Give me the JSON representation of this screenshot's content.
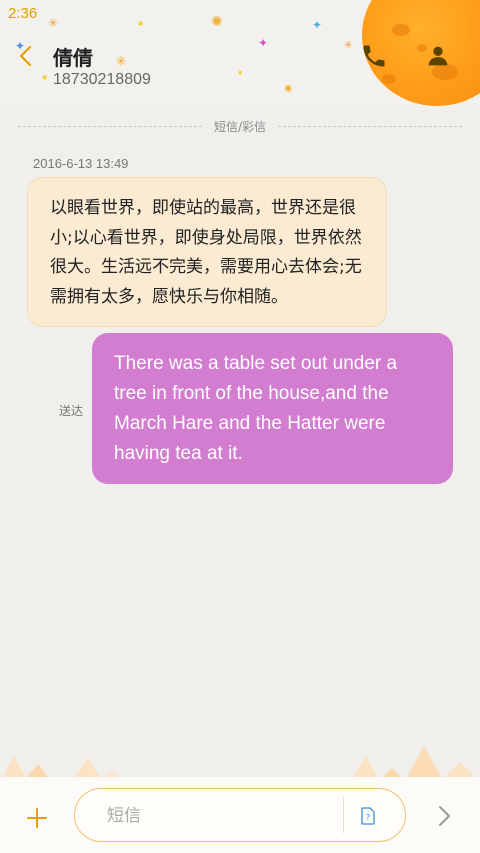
{
  "status_bar": {
    "time": "2:36"
  },
  "header": {
    "contact_name": "倩倩",
    "phone_number": "18730218809",
    "icons": {
      "back": "back-arrow-icon",
      "call": "phone-icon",
      "contact": "person-icon"
    }
  },
  "divider": {
    "label": "短信/彩信"
  },
  "conversation": {
    "timestamp": "2016-6-13 13:49",
    "incoming_message": "以眼看世界，即使站的最高，世界还是很小;以心看世界，即使身处局限，世界依然很大。生活远不完美，需要用心去体会;无需拥有太多，愿快乐与你相随。",
    "outgoing_message": "There was a table set out under a tree in front of the house,and the March Hare and the Hatter were having tea at it.",
    "outgoing_status": "送达"
  },
  "composer": {
    "placeholder": "短信",
    "icons": {
      "add": "plus-icon",
      "attach": "sim-card-icon",
      "send": "chevron-right-icon"
    }
  },
  "colors": {
    "accent": "#e1a100",
    "incoming_bubble": "#fbebd2",
    "outgoing_bubble": "#d27dcf",
    "moon": "#ff9b18"
  }
}
